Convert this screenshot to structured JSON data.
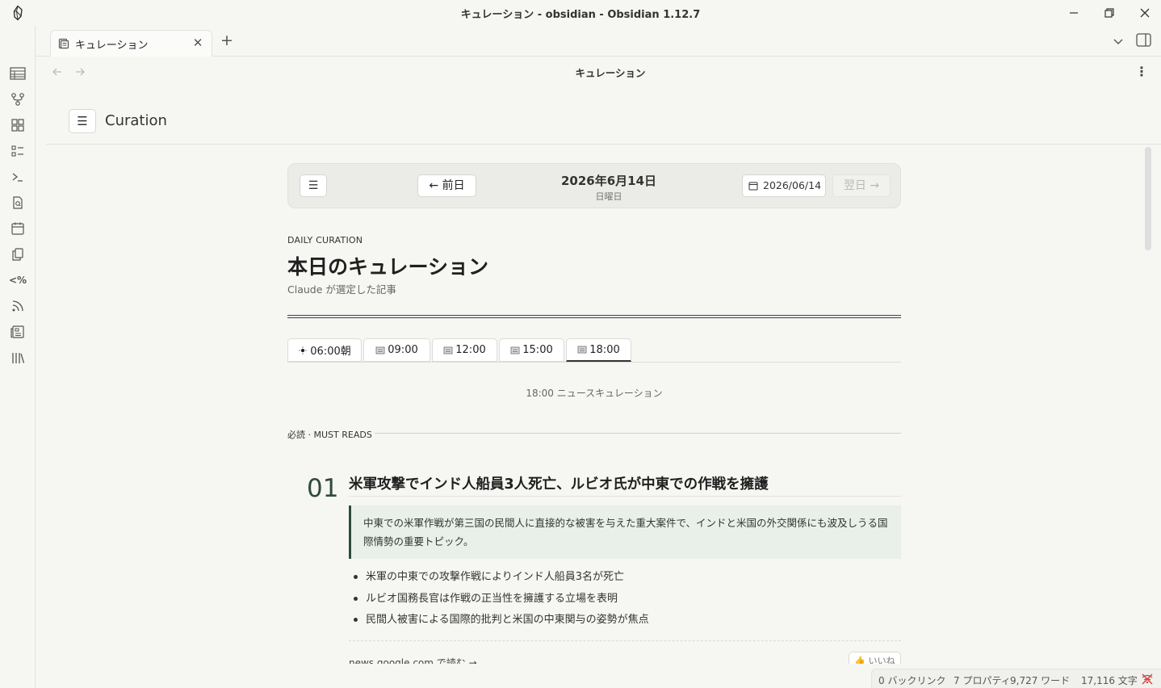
{
  "window": {
    "title": "キュレーション - obsidian - Obsidian 1.12.7"
  },
  "tabs": [
    {
      "label": "キュレーション"
    }
  ],
  "view": {
    "title": "キュレーション"
  },
  "curation_header": {
    "menu_glyph": "☰",
    "title": "Curation"
  },
  "date_nav": {
    "menu_glyph": "☰",
    "prev_label": "← 前日",
    "date": "2026年6月14日",
    "weekday": "日曜日",
    "picker_value": "2026/06/14",
    "next_label": "翌日 →"
  },
  "hero": {
    "kicker": "DAILY CURATION",
    "title": "本日のキュレーション",
    "byline": "Claude が選定した記事"
  },
  "time_tabs": [
    {
      "label": "06:00朝",
      "icon": "sun-icon"
    },
    {
      "label": "09:00",
      "icon": "newspaper-icon"
    },
    {
      "label": "12:00",
      "icon": "newspaper-icon"
    },
    {
      "label": "15:00",
      "icon": "newspaper-icon"
    },
    {
      "label": "18:00",
      "icon": "newspaper-icon",
      "active": true
    }
  ],
  "session_caption": "18:00 ニュースキュレーション",
  "section": {
    "label": "必読 · MUST READS"
  },
  "article": {
    "number": "01",
    "title": "米軍攻撃でインド人船員3人死亡、ルビオ氏が中東での作戦を擁護",
    "summary": "中東での米軍作戦が第三国の民間人に直接的な被害を与えた重大案件で、インドと米国の外交関係にも波及しうる国際情勢の重要トピック。",
    "bullets": [
      "米軍の中東での攻撃作戦によりインド人船員3名が死亡",
      "ルビオ国務長官は作戦の正当性を擁護する立場を表明",
      "民間人被害による国際的批判と米国の中東関与の姿勢が焦点"
    ],
    "source": "news.google.com で読む →",
    "like": "👍 いいね"
  },
  "status_bar": {
    "backlinks": "0 バックリンク",
    "properties": "7 プロパティ",
    "words": "9,727 ワード",
    "chars": "17,116 文字"
  },
  "colors": {
    "accent": "#2f4a3e",
    "summary_bg": "#e8f0e9",
    "background": "#f6f6f3"
  }
}
